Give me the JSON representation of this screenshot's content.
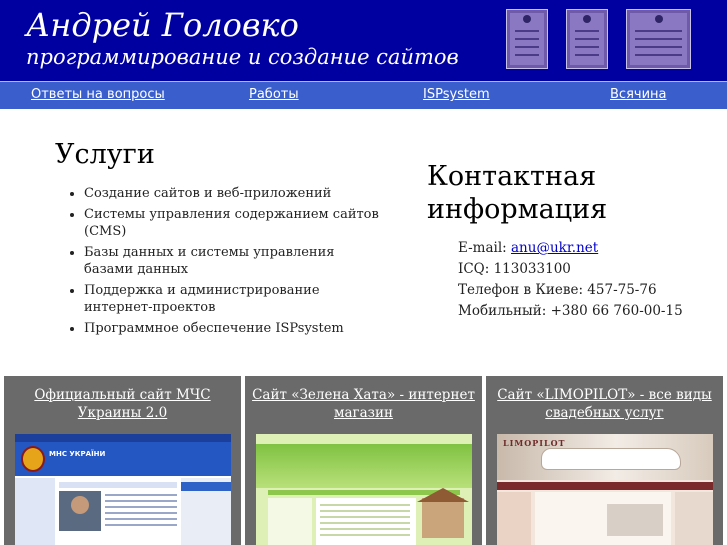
{
  "header": {
    "title": "Андрей Головко",
    "subtitle": "программирование и создание сайтов",
    "background": "#0000a0"
  },
  "nav": {
    "background": "#3a5fcd",
    "items": [
      {
        "label": "Ответы на вопросы"
      },
      {
        "label": "Работы"
      },
      {
        "label": "ISPsystem"
      },
      {
        "label": "Всячина"
      }
    ]
  },
  "services": {
    "title": "Услуги",
    "items": [
      "Создание сайтов и веб-приложений",
      "Системы управления содержанием сайтов (CMS)",
      "Базы данных и системы управления базами данных",
      "Поддержка и администрирование интернет-проектов",
      "Программное обеспечение ISPsystem"
    ]
  },
  "contact": {
    "title": "Контактная информация",
    "email_label": "E-mail:",
    "email": "anu@ukr.net",
    "icq": "ICQ: 113033100",
    "phone": "Телефон в Киеве: 457-75-76",
    "mobile": "Мобильный: +380 66 760-00-15"
  },
  "portfolio": {
    "items": [
      {
        "title": "Официальный сайт МЧС Украины 2.0",
        "screenshot_text": "МНС УКРАЇНИ"
      },
      {
        "title": "Сайт «Зелена Хата» - интернет магазин"
      },
      {
        "title": "Сайт «LIMOPILOT» - все виды свадебных услуг",
        "screenshot_text": "LIMOPILOT"
      }
    ]
  },
  "colors": {
    "card_background": "#6a6a6a",
    "link": "#0000cc"
  },
  "icons": [
    "certificate-icon",
    "certificate-icon",
    "certificate-icon"
  ]
}
